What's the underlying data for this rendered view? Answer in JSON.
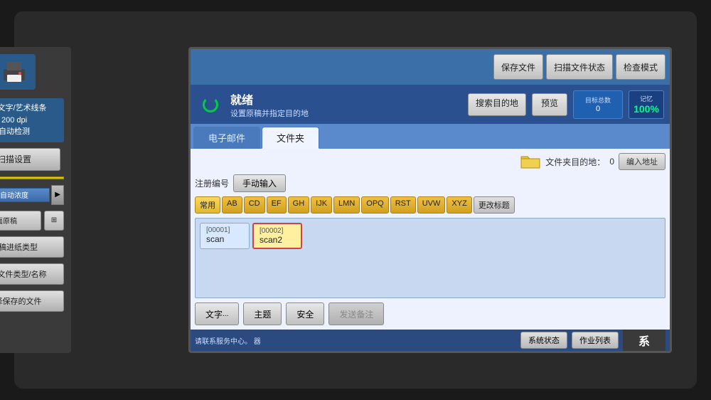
{
  "header": {
    "save_file": "保存文件",
    "scan_status": "扫描文件状态",
    "check_mode": "检查模式"
  },
  "status": {
    "ready_title": "就绪",
    "ready_subtitle": "设置原稿并指定目的地",
    "search_dest": "搜索目的地",
    "preview": "预览",
    "target_count_label": "目标总数",
    "target_count": "0",
    "memory_label": "记忆",
    "memory_value": "100%"
  },
  "left_panel": {
    "info_line1": "黑白文字/艺术线条",
    "info_line2": "200 dpi",
    "info_line3": "自动检测",
    "scan_settings": "扫描设置",
    "auto_density": "自动浓度",
    "single_original": "单面原稿",
    "original_paper_type": "原稿进纸类型",
    "send_file_type": "发送文件类型/名称",
    "select_save_file": "选择保存的文件"
  },
  "tabs": {
    "email": "电子邮件",
    "folder": "文件夹"
  },
  "folder_tab": {
    "dest_label": "文件夹目的地：",
    "dest_count": "0",
    "enter_addr": "编入地址",
    "register_num": "注册编号",
    "manual_input": "手动输入",
    "alpha_tabs": [
      "常用",
      "AB",
      "CD",
      "EF",
      "GH",
      "IJK",
      "LMN",
      "OPQ",
      "RST",
      "UVW",
      "XYZ",
      "更改标题"
    ]
  },
  "files": [
    {
      "num": "[00001]",
      "name": "scan",
      "selected": false
    },
    {
      "num": "[00002]",
      "name": "scan2",
      "selected": true
    }
  ],
  "bottom_actions": {
    "text_btn": "文字",
    "ellipsis": "...",
    "subject_btn": "主题",
    "security_btn": "安全",
    "send_notice_btn": "发送备注"
  },
  "bottom_status": {
    "help_text": "请联系服务中心。\n器",
    "system_state": "系统状态",
    "job_list": "作业列表",
    "system_label": "系"
  }
}
